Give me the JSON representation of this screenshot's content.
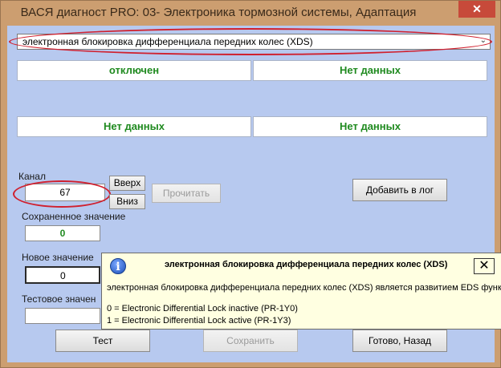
{
  "window": {
    "title": "ВАСЯ диагност PRO: 03- Электроника тормозной системы, Адаптация",
    "close_glyph": "✕"
  },
  "function_select": {
    "value": "электронная блокировка дифференциала передних колес (XDS)",
    "arrow": "⌄"
  },
  "values": {
    "top_left": "отключен",
    "top_right": "Нет данных",
    "mid_left": "Нет данных",
    "mid_right": "Нет данных"
  },
  "channel": {
    "label": "Канал",
    "value": "67",
    "up_label": "Вверх",
    "down_label": "Вниз",
    "read_label": "Прочитать"
  },
  "saved": {
    "label": "Сохраненное значение",
    "value": "0"
  },
  "new_value": {
    "label": "Новое значение",
    "value": "0"
  },
  "test_value": {
    "label": "Тестовое значен"
  },
  "buttons": {
    "add_log": "Добавить в лог",
    "test": "Тест",
    "save": "Сохранить",
    "done": "Готово, Назад"
  },
  "tooltip": {
    "icon": "i",
    "title": "электронная блокировка дифференциала передних колес (XDS)",
    "close": "✕",
    "line1": "электронная блокировка дифференциала передних колес (XDS) является развитием EDS функци",
    "line2": "0 = Electronic Differential Lock inactive (PR-1Y0)",
    "line3": "1 = Electronic Differential Lock active (PR-1Y3)"
  },
  "colors": {
    "client_bg": "#b7c9ef",
    "value_green": "#1f8a1f",
    "highlight_red": "#d0202e"
  }
}
